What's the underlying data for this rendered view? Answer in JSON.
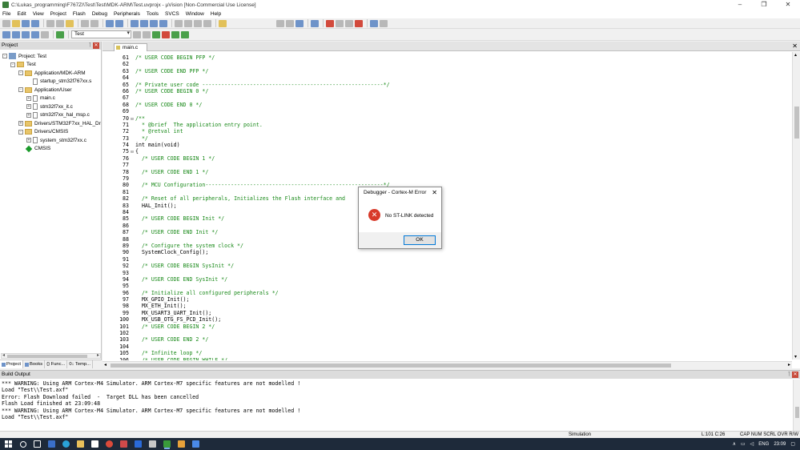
{
  "window": {
    "title": "C:\\Lukas_programming\\F767ZI\\Test\\Test\\MDK-ARM\\Test.uvprojx - µVision  [Non-Commercial Use License]",
    "minimize": "–",
    "maximize": "❐",
    "close": "✕"
  },
  "menu": [
    "File",
    "Edit",
    "View",
    "Project",
    "Flash",
    "Debug",
    "Peripherals",
    "Tools",
    "SVCS",
    "Window",
    "Help"
  ],
  "toolbar": {
    "target": "Test"
  },
  "project_panel": {
    "title": "Project",
    "pin": "ᛙ",
    "close": "✕",
    "tree": [
      {
        "label": "Project: Test",
        "level": 0,
        "icon": "project-icon",
        "toggle": "-"
      },
      {
        "label": "Test",
        "level": 1,
        "icon": "folder-icon",
        "toggle": "-"
      },
      {
        "label": "Application/MDK-ARM",
        "level": 2,
        "icon": "folder-icon",
        "toggle": "-"
      },
      {
        "label": "startup_stm32f767xx.s",
        "level": 3,
        "icon": "file-icon",
        "toggle": ""
      },
      {
        "label": "Application/User",
        "level": 2,
        "icon": "folder-icon",
        "toggle": "-"
      },
      {
        "label": "main.c",
        "level": 3,
        "icon": "file-icon",
        "toggle": "+"
      },
      {
        "label": "stm32f7xx_it.c",
        "level": 3,
        "icon": "file-icon",
        "toggle": "+"
      },
      {
        "label": "stm32f7xx_hal_msp.c",
        "level": 3,
        "icon": "file-icon",
        "toggle": "+"
      },
      {
        "label": "Drivers/STM32F7xx_HAL_Driv",
        "level": 2,
        "icon": "folder-icon",
        "toggle": "+"
      },
      {
        "label": "Drivers/CMSIS",
        "level": 2,
        "icon": "folder-icon",
        "toggle": "-"
      },
      {
        "label": "system_stm32f7xx.c",
        "level": 3,
        "icon": "file-icon",
        "toggle": "+"
      },
      {
        "label": "CMSIS",
        "level": 2,
        "icon": "diamond-icon",
        "toggle": ""
      }
    ],
    "tabs": [
      "Project",
      "Books",
      "{} Func...",
      "0↓ Temp..."
    ]
  },
  "editor": {
    "tab": "main.c",
    "close": "✕",
    "lines": [
      {
        "n": "61",
        "fold": "",
        "text": "/* USER CODE BEGIN PFP */",
        "kind": "comment"
      },
      {
        "n": "62",
        "fold": "",
        "text": "",
        "kind": "code"
      },
      {
        "n": "63",
        "fold": "",
        "text": "/* USER CODE END PFP */",
        "kind": "comment"
      },
      {
        "n": "64",
        "fold": "",
        "text": "",
        "kind": "code"
      },
      {
        "n": "65",
        "fold": "",
        "text": "/* Private user code ---------------------------------------------------------*/",
        "kind": "comment"
      },
      {
        "n": "66",
        "fold": "",
        "text": "/* USER CODE BEGIN 0 */",
        "kind": "comment"
      },
      {
        "n": "67",
        "fold": "",
        "text": "",
        "kind": "code"
      },
      {
        "n": "68",
        "fold": "",
        "text": "/* USER CODE END 0 */",
        "kind": "comment"
      },
      {
        "n": "69",
        "fold": "",
        "text": "",
        "kind": "code"
      },
      {
        "n": "70",
        "fold": "⊟",
        "text": "/**",
        "kind": "comment"
      },
      {
        "n": "71",
        "fold": "",
        "text": "  * @brief  The application entry point.",
        "kind": "comment"
      },
      {
        "n": "72",
        "fold": "",
        "text": "  * @retval int",
        "kind": "comment"
      },
      {
        "n": "73",
        "fold": "",
        "text": "  */",
        "kind": "comment"
      },
      {
        "n": "74",
        "fold": "",
        "text": "int main(void)",
        "kind": "code"
      },
      {
        "n": "75",
        "fold": "⊟",
        "text": "{",
        "kind": "code"
      },
      {
        "n": "76",
        "fold": "",
        "text": "  /* USER CODE BEGIN 1 */",
        "kind": "comment"
      },
      {
        "n": "77",
        "fold": "",
        "text": "",
        "kind": "code"
      },
      {
        "n": "78",
        "fold": "",
        "text": "  /* USER CODE END 1 */",
        "kind": "comment"
      },
      {
        "n": "79",
        "fold": "",
        "text": "",
        "kind": "code"
      },
      {
        "n": "80",
        "fold": "",
        "text": "  /* MCU Configuration--------------------------------------------------------*/",
        "kind": "comment"
      },
      {
        "n": "81",
        "fold": "",
        "text": "",
        "kind": "code"
      },
      {
        "n": "82",
        "fold": "",
        "text": "  /* Reset of all peripherals, Initializes the Flash interface and",
        "kind": "comment"
      },
      {
        "n": "83",
        "fold": "",
        "text": "  HAL_Init();",
        "kind": "code"
      },
      {
        "n": "84",
        "fold": "",
        "text": "",
        "kind": "code"
      },
      {
        "n": "85",
        "fold": "",
        "text": "  /* USER CODE BEGIN Init */",
        "kind": "comment"
      },
      {
        "n": "86",
        "fold": "",
        "text": "",
        "kind": "code"
      },
      {
        "n": "87",
        "fold": "",
        "text": "  /* USER CODE END Init */",
        "kind": "comment"
      },
      {
        "n": "88",
        "fold": "",
        "text": "",
        "kind": "code"
      },
      {
        "n": "89",
        "fold": "",
        "text": "  /* Configure the system clock */",
        "kind": "comment"
      },
      {
        "n": "90",
        "fold": "",
        "text": "  SystemClock_Config();",
        "kind": "code"
      },
      {
        "n": "91",
        "fold": "",
        "text": "",
        "kind": "code"
      },
      {
        "n": "92",
        "fold": "",
        "text": "  /* USER CODE BEGIN SysInit */",
        "kind": "comment"
      },
      {
        "n": "93",
        "fold": "",
        "text": "",
        "kind": "code"
      },
      {
        "n": "94",
        "fold": "",
        "text": "  /* USER CODE END SysInit */",
        "kind": "comment"
      },
      {
        "n": "95",
        "fold": "",
        "text": "",
        "kind": "code"
      },
      {
        "n": "96",
        "fold": "",
        "text": "  /* Initialize all configured peripherals */",
        "kind": "comment"
      },
      {
        "n": "97",
        "fold": "",
        "text": "  MX_GPIO_Init();",
        "kind": "code"
      },
      {
        "n": "98",
        "fold": "",
        "text": "  MX_ETH_Init();",
        "kind": "code"
      },
      {
        "n": "99",
        "fold": "",
        "text": "  MX_USART3_UART_Init();",
        "kind": "code"
      },
      {
        "n": "100",
        "fold": "",
        "text": "  MX_USB_OTG_FS_PCD_Init();",
        "kind": "code"
      },
      {
        "n": "101",
        "fold": "",
        "text": "  /* USER CODE BEGIN 2 */",
        "kind": "comment"
      },
      {
        "n": "102",
        "fold": "",
        "text": "",
        "kind": "code"
      },
      {
        "n": "103",
        "fold": "",
        "text": "  /* USER CODE END 2 */",
        "kind": "comment"
      },
      {
        "n": "104",
        "fold": "",
        "text": "",
        "kind": "code"
      },
      {
        "n": "105",
        "fold": "",
        "text": "  /* Infinite loop */",
        "kind": "comment"
      },
      {
        "n": "106",
        "fold": "",
        "text": "  /* USER CODE BEGIN WHILE */",
        "kind": "comment"
      }
    ]
  },
  "dialog": {
    "title": "Debugger - Cortex-M Error",
    "close": "✕",
    "icon": "error-icon",
    "icon_glyph": "✕",
    "message": "No ST-LINK detected",
    "ok": "OK"
  },
  "build_output": {
    "title": "Build Output",
    "pin": "ᛙ",
    "close": "✕",
    "lines": [
      "*** WARNING: Using ARM Cortex-M4 Simulator. ARM Cortex-M7 specific features are not modelled !",
      "Load \"Test\\\\Test.axf\"",
      "Error: Flash Download failed  -  Target DLL has been cancelled",
      "Flash Load finished at 23:09:48",
      "*** WARNING: Using ARM Cortex-M4 Simulator. ARM Cortex-M7 specific features are not modelled !",
      "Load \"Test\\\\Test.axf\""
    ]
  },
  "statusbar": {
    "mode": "Simulation",
    "position": "L:101 C:26",
    "indicators": "CAP  NUM  SCRL  OVR  R/W"
  },
  "taskbar": {
    "tray_arrow": "∧",
    "language": "ENG",
    "time": "23:09"
  },
  "colors": {
    "comment": "#1a8a1a",
    "taskbar": "#1e2a3a",
    "error": "#d83a2a"
  }
}
